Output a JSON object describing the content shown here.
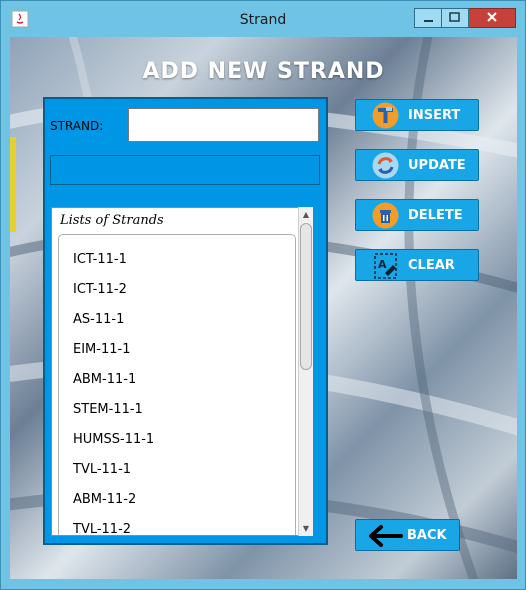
{
  "window": {
    "title": "Strand"
  },
  "form": {
    "heading": "ADD NEW STRAND",
    "strand_label": "STRAND:",
    "strand_value": "",
    "message": ""
  },
  "list": {
    "title": "Lists of Strands",
    "items": [
      "ICT-11-1",
      "ICT-11-2",
      "AS-11-1",
      "EIM-11-1",
      "ABM-11-1",
      "STEM-11-1",
      "HUMSS-11-1",
      "TVL-11-1",
      "ABM-11-2",
      "TVL-11-2"
    ]
  },
  "buttons": {
    "insert": {
      "label": "INSERT",
      "icon": "insert-icon"
    },
    "update": {
      "label": "UPDATE",
      "icon": "update-icon"
    },
    "delete": {
      "label": "DELETE",
      "icon": "trash-icon"
    },
    "clear": {
      "label": "CLEAR",
      "icon": "clear-icon"
    },
    "back": {
      "label": "BACK",
      "icon": "back-arrow-icon"
    }
  },
  "colors": {
    "panel": "#0096e6",
    "button": "#18a6e6",
    "close": "#c6413a"
  }
}
